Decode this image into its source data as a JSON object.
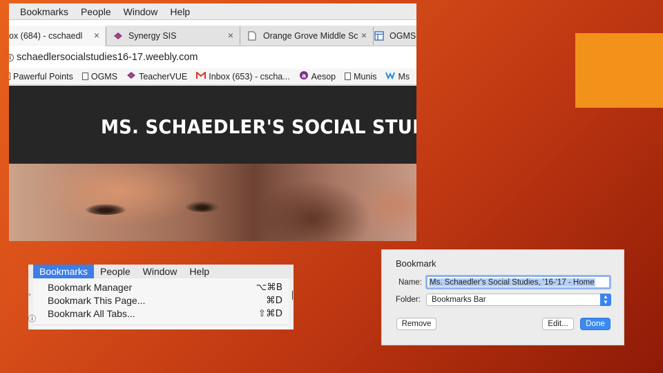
{
  "browser": {
    "menu": [
      "Bookmarks",
      "People",
      "Window",
      "Help"
    ],
    "tabs": [
      {
        "label": "ox (684) - cschaedl",
        "icon": "gmail-icon",
        "active": true
      },
      {
        "label": "Synergy SIS",
        "icon": "synergy-icon",
        "active": false
      },
      {
        "label": "Orange Grove Middle Sc",
        "icon": "page-icon",
        "active": false
      },
      {
        "label": "OGMS",
        "icon": "site-icon",
        "active": false
      }
    ],
    "tab_close": "×",
    "url": "schaedlersocialstudies16-17.weebly.com",
    "bookmarks_bar": [
      {
        "label": "Pawerful Points",
        "icon": "page-icon"
      },
      {
        "label": "OGMS",
        "icon": "page-icon"
      },
      {
        "label": "TeacherVUE",
        "icon": "synergy-icon"
      },
      {
        "label": "Inbox (653) - cscha...",
        "icon": "gmail-icon"
      },
      {
        "label": "Aesop",
        "icon": "aesop-icon"
      },
      {
        "label": "Munis",
        "icon": "page-icon"
      },
      {
        "label": "Ms",
        "icon": "weebly-icon"
      }
    ],
    "site_title": "MS. SCHAEDLER'S SOCIAL STUDIE"
  },
  "bookmarks_menu": {
    "menu": [
      "Bookmarks",
      "People",
      "Window",
      "Help"
    ],
    "items": [
      {
        "label": "Bookmark Manager",
        "shortcut": "⌥⌘B"
      },
      {
        "label": "Bookmark This Page...",
        "shortcut": "⌘D"
      },
      {
        "label": "Bookmark All Tabs...",
        "shortcut": "⇧⌘D"
      }
    ]
  },
  "bookmark_dialog": {
    "title": "Bookmark",
    "name_label": "Name:",
    "name_value": "Ms. Schaedler's Social Studies, '16-'17 - Home",
    "folder_label": "Folder:",
    "folder_value": "Bookmarks Bar",
    "remove_label": "Remove",
    "edit_label": "Edit...",
    "done_label": "Done"
  },
  "colors": {
    "accent_orange": "#f2921b",
    "selection_blue": "#3b7ee8"
  }
}
